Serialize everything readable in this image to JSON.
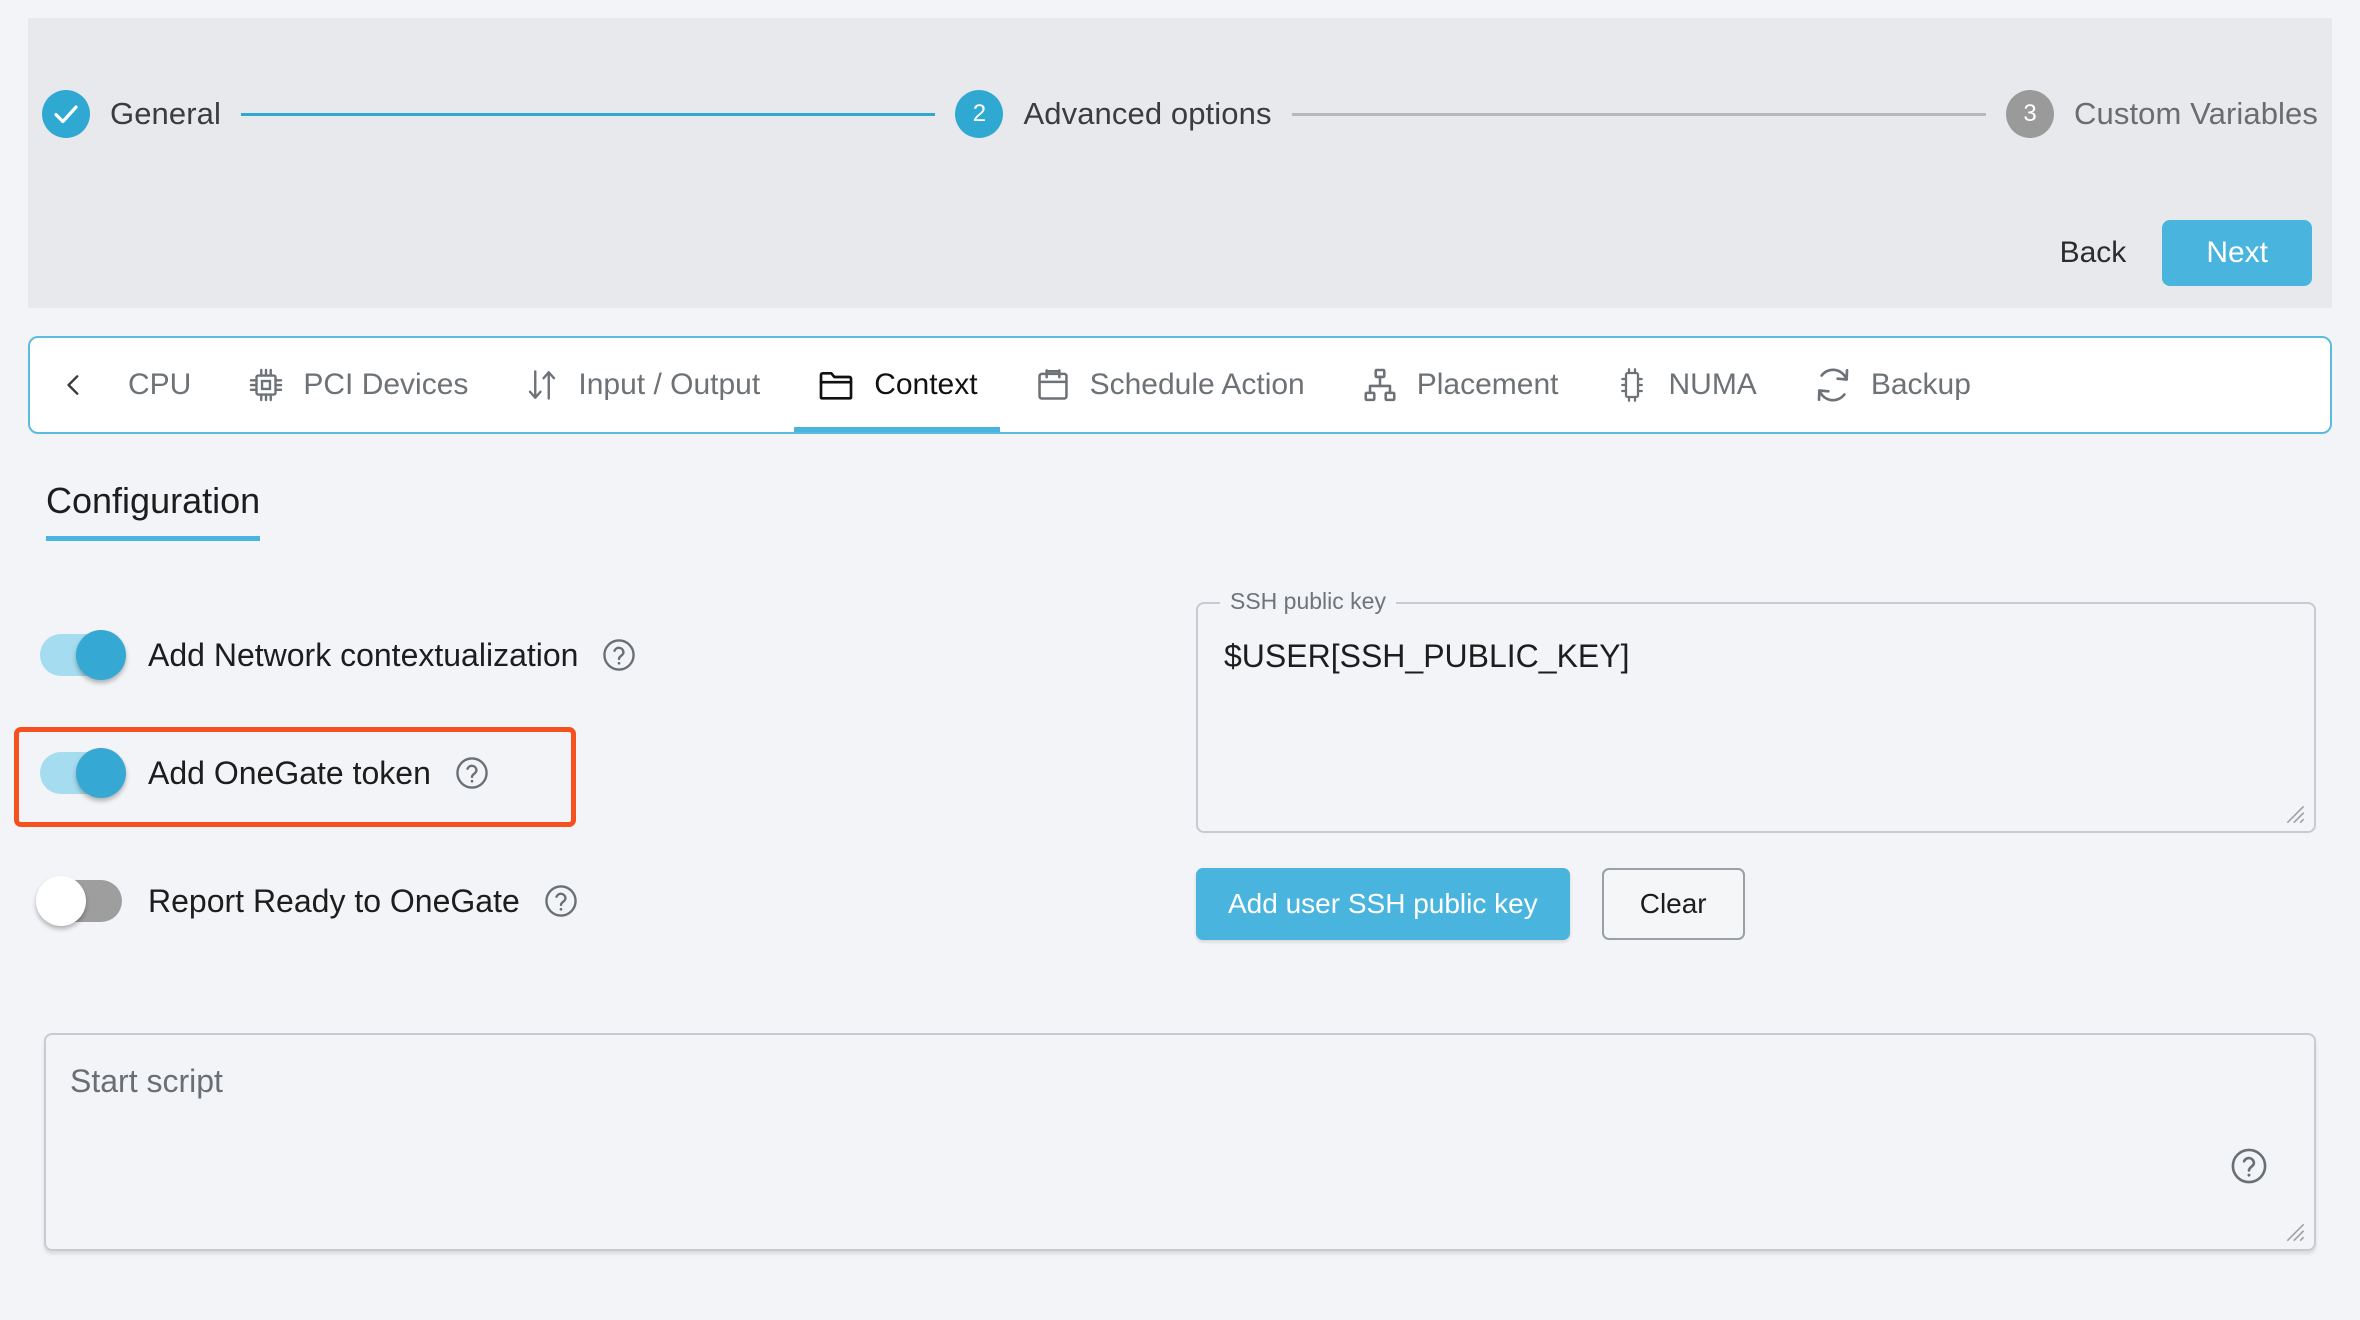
{
  "wizard": {
    "steps": [
      {
        "id": "general",
        "marker": "check",
        "label": "General",
        "state": "done"
      },
      {
        "id": "advanced-options",
        "marker": "2",
        "label": "Advanced options",
        "state": "current"
      },
      {
        "id": "custom-variables",
        "marker": "3",
        "label": "Custom Variables",
        "state": "todo"
      }
    ],
    "back_label": "Back",
    "next_label": "Next"
  },
  "tabs": {
    "scroll_prev_icon": "chevron-left-icon",
    "items": [
      {
        "id": "cpu",
        "label": "CPU",
        "icon": "",
        "active": false
      },
      {
        "id": "pci-devices",
        "label": "PCI Devices",
        "icon": "chip-icon",
        "active": false
      },
      {
        "id": "input-output",
        "label": "Input / Output",
        "icon": "arrows-icon",
        "active": false
      },
      {
        "id": "context",
        "label": "Context",
        "icon": "folder-icon",
        "active": true
      },
      {
        "id": "schedule-action",
        "label": "Schedule Action",
        "icon": "calendar-icon",
        "active": false
      },
      {
        "id": "placement",
        "label": "Placement",
        "icon": "sitemap-icon",
        "active": false
      },
      {
        "id": "numa",
        "label": "NUMA",
        "icon": "chip-vert-icon",
        "active": false
      },
      {
        "id": "backup",
        "label": "Backup",
        "icon": "refresh-icon",
        "active": false
      }
    ]
  },
  "configuration": {
    "title": "Configuration",
    "toggles": [
      {
        "id": "add-network-contextualization",
        "label": "Add Network contextualization",
        "state": "on",
        "help": "?"
      },
      {
        "id": "add-onegate-token",
        "label": "Add OneGate token",
        "state": "on",
        "help": "?"
      },
      {
        "id": "report-ready-to-onegate",
        "label": "Report Ready to OneGate",
        "state": "off",
        "help": "?"
      }
    ],
    "highlight_color": "#f4511e"
  },
  "ssh": {
    "legend": "SSH public key",
    "value": "$USER[SSH_PUBLIC_KEY]",
    "add_button": "Add user SSH public key",
    "clear_button": "Clear"
  },
  "script": {
    "placeholder": "Start script",
    "help": "?"
  },
  "colors": {
    "accent": "#49b4dd",
    "accent_dark": "#2fa8d2",
    "highlight": "#f4511e",
    "header_bg": "#e7e9ed",
    "page_bg": "#f2f4f7",
    "muted": "#9a9a9a"
  }
}
